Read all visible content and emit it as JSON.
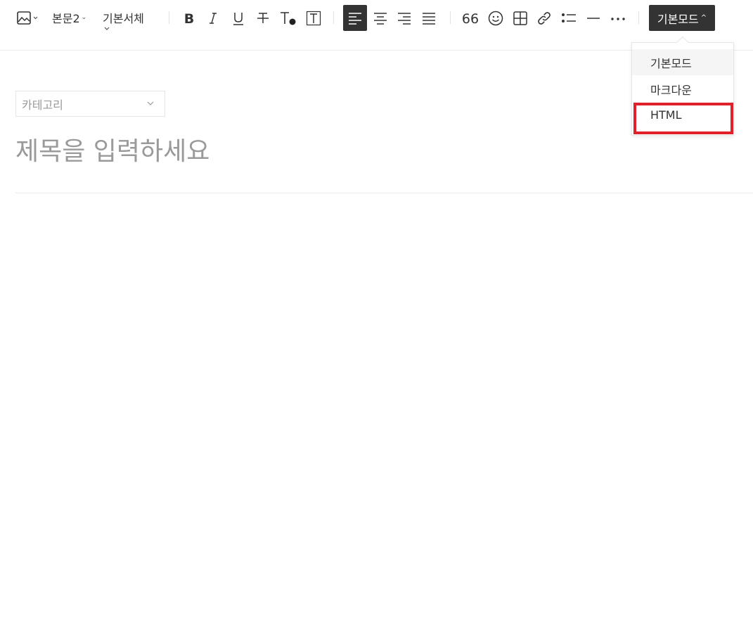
{
  "toolbar": {
    "paragraph_style": "본문2",
    "font_family": "기본서체",
    "mode_button": "기본모드",
    "icons": [
      "image-icon",
      "bold-icon",
      "italic-icon",
      "underline-icon",
      "strikethrough-icon",
      "text-color-icon",
      "text-background-icon",
      "align-left-icon",
      "align-center-icon",
      "align-right-icon",
      "align-justify-icon",
      "quote-icon",
      "emoji-icon",
      "table-icon",
      "link-icon",
      "list-icon",
      "horizontal-rule-icon",
      "more-icon"
    ]
  },
  "mode_menu": {
    "items": [
      {
        "label": "기본모드",
        "selected": true
      },
      {
        "label": "마크다운",
        "selected": false
      },
      {
        "label": "HTML",
        "selected": false
      }
    ],
    "highlight_color": "#e0202a"
  },
  "editor": {
    "category_placeholder": "카테고리",
    "title_placeholder": "제목을 입력하세요"
  },
  "colors": {
    "dark_button": "#333333",
    "highlight": "#e0202a"
  }
}
